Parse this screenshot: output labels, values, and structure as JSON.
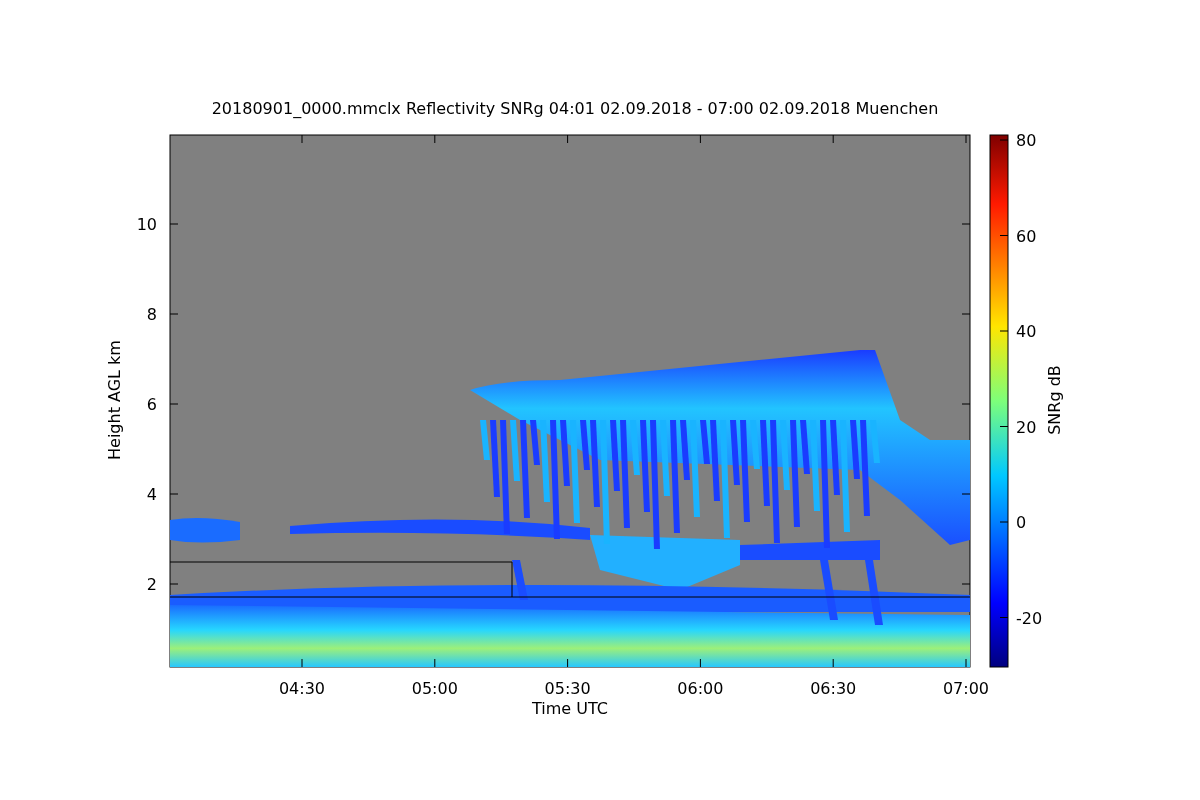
{
  "figure": {
    "title": "20180901_0000.mmclx Reflectivity SNRg   04:01 02.09.2018 - 07:00 02.09.2018 Muenchen",
    "xlabel": "Time UTC",
    "ylabel": "Height AGL km",
    "xticks": [
      "04:30",
      "05:00",
      "05:30",
      "06:00",
      "06:30",
      "07:00"
    ],
    "yticks": [
      "10",
      "8",
      "6",
      "4",
      "2"
    ],
    "colorbar": {
      "label": "SNRg dB",
      "ticks": [
        "80",
        "60",
        "40",
        "20",
        "0",
        "-20"
      ]
    }
  }
}
